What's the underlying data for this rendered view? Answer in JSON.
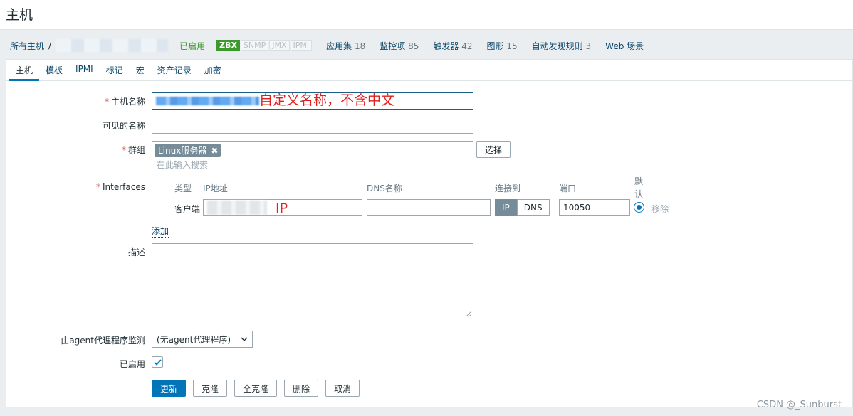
{
  "page": {
    "title": "主机"
  },
  "breadcrumb": {
    "all_hosts": "所有主机",
    "separator": "/",
    "enabled": "已启用",
    "badges": [
      "ZBX",
      "SNMP",
      "JMX",
      "IPMI"
    ],
    "items": [
      {
        "label": "应用集",
        "count": "18"
      },
      {
        "label": "监控项",
        "count": "85"
      },
      {
        "label": "触发器",
        "count": "42"
      },
      {
        "label": "图形",
        "count": "15"
      },
      {
        "label": "自动发现规则",
        "count": "3"
      },
      {
        "label": "Web 场景",
        "count": ""
      }
    ]
  },
  "tabs": [
    "主机",
    "模板",
    "IPMI",
    "标记",
    "宏",
    "资产记录",
    "加密"
  ],
  "form": {
    "host_name": {
      "label": "主机名称",
      "annotation": "自定义名称，不含中文"
    },
    "visible_name": {
      "label": "可见的名称",
      "value": ""
    },
    "groups": {
      "label": "群组",
      "chip": "Linux服务器",
      "chip_remove": "✖",
      "placeholder": "在此输入搜索",
      "select_button": "选择"
    },
    "interfaces": {
      "label": "Interfaces",
      "headers": {
        "type": "类型",
        "ip": "IP地址",
        "dns": "DNS名称",
        "connect": "连接到",
        "port": "端口",
        "default_line1": "默",
        "default_line2": "认"
      },
      "row": {
        "type": "客户端",
        "ip_annotation": "IP",
        "dns_value": "",
        "connect_ip": "IP",
        "connect_dns": "DNS",
        "port": "10050",
        "remove": "移除"
      },
      "add": "添加"
    },
    "description": {
      "label": "描述",
      "value": ""
    },
    "proxy": {
      "label": "由agent代理程序监测",
      "value": "(无agent代理程序)"
    },
    "enabled": {
      "label": "已启用",
      "checked": true
    }
  },
  "buttons": {
    "update": "更新",
    "clone": "克隆",
    "full_clone": "全克隆",
    "delete": "删除",
    "cancel": "取消"
  },
  "watermark": "CSDN @_Sunburst"
}
